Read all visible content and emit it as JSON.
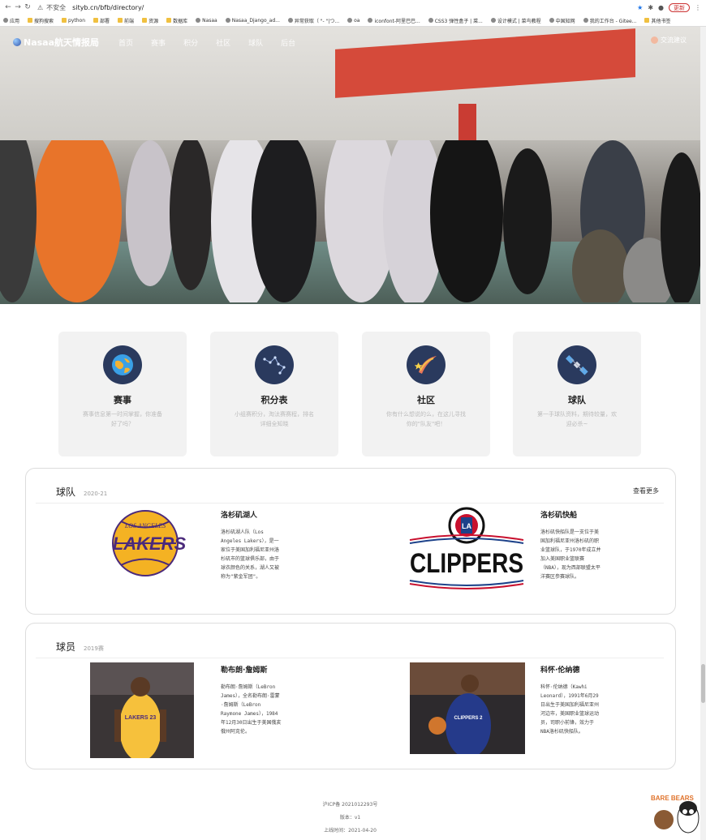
{
  "browser": {
    "insecure_label": "不安全",
    "url": "sityb.cn/bfb/directory/",
    "update_label": "更新",
    "bookmarks": [
      "应用",
      "搜狗搜索",
      "python",
      "部署",
      "前端",
      "资源",
      "数据库",
      "Nasaa",
      "Nasaa_Django_ad...",
      "异常获取（ \"- \"|つ...",
      "oa",
      "iconfont-阿里巴巴...",
      "CSS3 弹性盒子 | 菜...",
      "设计模式 | 菜鸟教程",
      "中国知网",
      "我的工作台 - Gitee...",
      "其他书签"
    ]
  },
  "nav": {
    "logo": "Nasaa航天情报局",
    "links": [
      "首页",
      "赛事",
      "积分",
      "社区",
      "球队",
      "后台"
    ],
    "login": "交流建议"
  },
  "features": [
    {
      "icon": "globe-icon",
      "title": "赛事",
      "desc": "赛事信息第一时间掌握，你准备好了吗？"
    },
    {
      "icon": "constellation-icon",
      "title": "积分表",
      "desc": "小组赛积分，淘汰赛赛程，排名详细全知晓"
    },
    {
      "icon": "comet-icon",
      "title": "社区",
      "desc": "你有什么想说的么，在这儿寻找你的\"队友\"吧！"
    },
    {
      "icon": "satellite-icon",
      "title": "球队",
      "desc": "第一手球队资料，期待较量，欢迎必杀~"
    }
  ],
  "teams": {
    "title": "球队",
    "subtitle": "2020-21",
    "more": "查看更多",
    "items": [
      {
        "name": "洛杉矶湖人",
        "logo_text": "LOS ANGELES LAKERS",
        "desc": "洛杉矶湖人队（Los Angeles Lakers），是一家位于美国加利福尼亚州洛杉矶市的篮球俱乐部，由于球衣颜色的关系，湖人又被称为\"紫金军团\"。"
      },
      {
        "name": "洛杉矶快船",
        "logo_text": "CLIPPERS",
        "logo_small": "LA",
        "desc": "洛杉矶快船队是一支位于美国加利福尼亚州洛杉矶的职业篮球队，于1970年成立并加入美国职业篮联赛（NBA），现为西部联盟太平洋赛区参赛球队。"
      }
    ]
  },
  "players": {
    "title": "球员",
    "subtitle": "2019赛",
    "items": [
      {
        "name": "勒布朗·詹姆斯",
        "jersey": "LAKERS 23",
        "desc": "勒布朗·詹姆斯（LeBron James），全名勒布朗·雷蒙·詹姆斯（LeBron Raymone James），1984年12月30日出生于美国俄亥俄州阿克伦。"
      },
      {
        "name": "科怀·伦纳德",
        "jersey": "CLIPPERS 2",
        "desc": "科怀·伦纳德（Kawhi Leonard），1991年6月29日出生于美国加利福尼亚州河边市，美国职业篮球运动员，司职小前锋，效力于NBA洛杉矶快船队。"
      }
    ]
  },
  "footer": {
    "icp": "沪ICP备 2021012293号",
    "version": "版本：v1",
    "launch": "上线时间：2021-04-20"
  },
  "mascot": {
    "text": "BARE BEARS"
  }
}
